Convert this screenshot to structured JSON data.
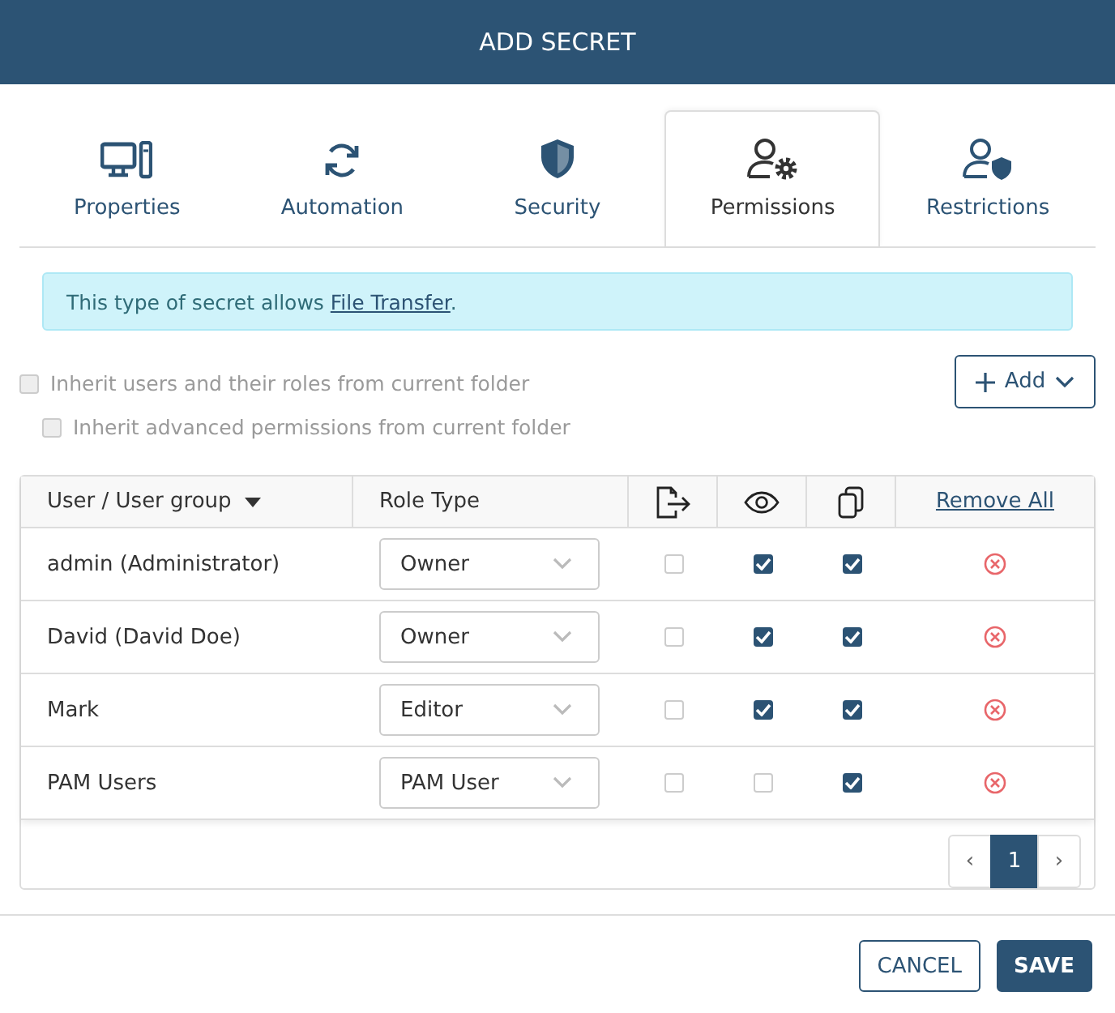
{
  "window": {
    "title": "ADD SECRET"
  },
  "tabs": [
    {
      "kind": "computer",
      "label": "Properties",
      "selected": false
    },
    {
      "kind": "sync",
      "label": "Automation",
      "selected": false
    },
    {
      "kind": "shield",
      "label": "Security",
      "selected": false
    },
    {
      "kind": "user-gear",
      "label": "Permissions",
      "selected": true
    },
    {
      "kind": "user-shield",
      "label": "Restrictions",
      "selected": false
    }
  ],
  "alert": {
    "text": "This type of secret allows ",
    "link": "File Transfer",
    "end": "."
  },
  "options": [
    {
      "label": "Inherit users and their roles from current folder",
      "checked": false,
      "disabled": true
    },
    {
      "label": "Inherit advanced permissions from current folder",
      "checked": false,
      "disabled": true
    }
  ],
  "add_button": {
    "label": "Add"
  },
  "table": {
    "columns": [
      {
        "kind": "sort",
        "label": "User / User group"
      },
      {
        "kind": "text",
        "label": "Role Type"
      },
      {
        "kind": "export-icon"
      },
      {
        "kind": "eye-icon"
      },
      {
        "kind": "copy-icon"
      },
      {
        "kind": "link",
        "label": "Remove All"
      }
    ],
    "rows": [
      {
        "user": "admin (Administrator)",
        "role": "Owner",
        "export": false,
        "view": true,
        "copy": true
      },
      {
        "user": "David (David Doe)",
        "role": "Owner",
        "export": false,
        "view": true,
        "copy": true
      },
      {
        "user": "Mark",
        "role": "Editor",
        "export": false,
        "view": true,
        "copy": true
      },
      {
        "user": "PAM Users",
        "role": "PAM User",
        "export": false,
        "view": false,
        "copy": true
      }
    ]
  },
  "pagination": {
    "prev": "‹",
    "pages": [
      {
        "label": "1",
        "selected": true
      }
    ],
    "next": "›"
  },
  "buttons": [
    {
      "kind": "secondary",
      "label": "CANCEL"
    },
    {
      "kind": "primary",
      "label": "SAVE"
    }
  ]
}
